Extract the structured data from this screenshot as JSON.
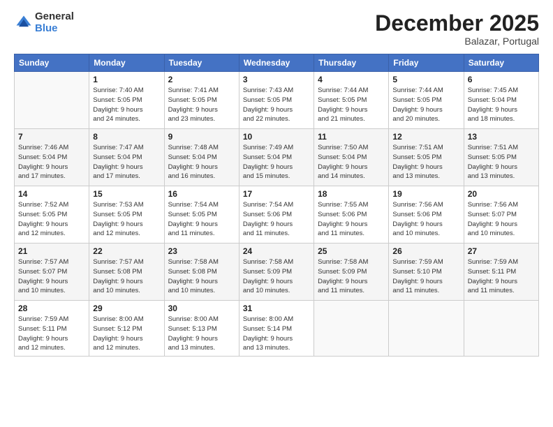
{
  "logo": {
    "general": "General",
    "blue": "Blue"
  },
  "title": "December 2025",
  "subtitle": "Balazar, Portugal",
  "weekdays": [
    "Sunday",
    "Monday",
    "Tuesday",
    "Wednesday",
    "Thursday",
    "Friday",
    "Saturday"
  ],
  "weeks": [
    [
      {
        "day": "",
        "info": ""
      },
      {
        "day": "1",
        "info": "Sunrise: 7:40 AM\nSunset: 5:05 PM\nDaylight: 9 hours\nand 24 minutes."
      },
      {
        "day": "2",
        "info": "Sunrise: 7:41 AM\nSunset: 5:05 PM\nDaylight: 9 hours\nand 23 minutes."
      },
      {
        "day": "3",
        "info": "Sunrise: 7:43 AM\nSunset: 5:05 PM\nDaylight: 9 hours\nand 22 minutes."
      },
      {
        "day": "4",
        "info": "Sunrise: 7:44 AM\nSunset: 5:05 PM\nDaylight: 9 hours\nand 21 minutes."
      },
      {
        "day": "5",
        "info": "Sunrise: 7:44 AM\nSunset: 5:05 PM\nDaylight: 9 hours\nand 20 minutes."
      },
      {
        "day": "6",
        "info": "Sunrise: 7:45 AM\nSunset: 5:04 PM\nDaylight: 9 hours\nand 18 minutes."
      }
    ],
    [
      {
        "day": "7",
        "info": "Sunrise: 7:46 AM\nSunset: 5:04 PM\nDaylight: 9 hours\nand 17 minutes."
      },
      {
        "day": "8",
        "info": "Sunrise: 7:47 AM\nSunset: 5:04 PM\nDaylight: 9 hours\nand 17 minutes."
      },
      {
        "day": "9",
        "info": "Sunrise: 7:48 AM\nSunset: 5:04 PM\nDaylight: 9 hours\nand 16 minutes."
      },
      {
        "day": "10",
        "info": "Sunrise: 7:49 AM\nSunset: 5:04 PM\nDaylight: 9 hours\nand 15 minutes."
      },
      {
        "day": "11",
        "info": "Sunrise: 7:50 AM\nSunset: 5:04 PM\nDaylight: 9 hours\nand 14 minutes."
      },
      {
        "day": "12",
        "info": "Sunrise: 7:51 AM\nSunset: 5:05 PM\nDaylight: 9 hours\nand 13 minutes."
      },
      {
        "day": "13",
        "info": "Sunrise: 7:51 AM\nSunset: 5:05 PM\nDaylight: 9 hours\nand 13 minutes."
      }
    ],
    [
      {
        "day": "14",
        "info": "Sunrise: 7:52 AM\nSunset: 5:05 PM\nDaylight: 9 hours\nand 12 minutes."
      },
      {
        "day": "15",
        "info": "Sunrise: 7:53 AM\nSunset: 5:05 PM\nDaylight: 9 hours\nand 12 minutes."
      },
      {
        "day": "16",
        "info": "Sunrise: 7:54 AM\nSunset: 5:05 PM\nDaylight: 9 hours\nand 11 minutes."
      },
      {
        "day": "17",
        "info": "Sunrise: 7:54 AM\nSunset: 5:06 PM\nDaylight: 9 hours\nand 11 minutes."
      },
      {
        "day": "18",
        "info": "Sunrise: 7:55 AM\nSunset: 5:06 PM\nDaylight: 9 hours\nand 11 minutes."
      },
      {
        "day": "19",
        "info": "Sunrise: 7:56 AM\nSunset: 5:06 PM\nDaylight: 9 hours\nand 10 minutes."
      },
      {
        "day": "20",
        "info": "Sunrise: 7:56 AM\nSunset: 5:07 PM\nDaylight: 9 hours\nand 10 minutes."
      }
    ],
    [
      {
        "day": "21",
        "info": "Sunrise: 7:57 AM\nSunset: 5:07 PM\nDaylight: 9 hours\nand 10 minutes."
      },
      {
        "day": "22",
        "info": "Sunrise: 7:57 AM\nSunset: 5:08 PM\nDaylight: 9 hours\nand 10 minutes."
      },
      {
        "day": "23",
        "info": "Sunrise: 7:58 AM\nSunset: 5:08 PM\nDaylight: 9 hours\nand 10 minutes."
      },
      {
        "day": "24",
        "info": "Sunrise: 7:58 AM\nSunset: 5:09 PM\nDaylight: 9 hours\nand 10 minutes."
      },
      {
        "day": "25",
        "info": "Sunrise: 7:58 AM\nSunset: 5:09 PM\nDaylight: 9 hours\nand 11 minutes."
      },
      {
        "day": "26",
        "info": "Sunrise: 7:59 AM\nSunset: 5:10 PM\nDaylight: 9 hours\nand 11 minutes."
      },
      {
        "day": "27",
        "info": "Sunrise: 7:59 AM\nSunset: 5:11 PM\nDaylight: 9 hours\nand 11 minutes."
      }
    ],
    [
      {
        "day": "28",
        "info": "Sunrise: 7:59 AM\nSunset: 5:11 PM\nDaylight: 9 hours\nand 12 minutes."
      },
      {
        "day": "29",
        "info": "Sunrise: 8:00 AM\nSunset: 5:12 PM\nDaylight: 9 hours\nand 12 minutes."
      },
      {
        "day": "30",
        "info": "Sunrise: 8:00 AM\nSunset: 5:13 PM\nDaylight: 9 hours\nand 13 minutes."
      },
      {
        "day": "31",
        "info": "Sunrise: 8:00 AM\nSunset: 5:14 PM\nDaylight: 9 hours\nand 13 minutes."
      },
      {
        "day": "",
        "info": ""
      },
      {
        "day": "",
        "info": ""
      },
      {
        "day": "",
        "info": ""
      }
    ]
  ]
}
